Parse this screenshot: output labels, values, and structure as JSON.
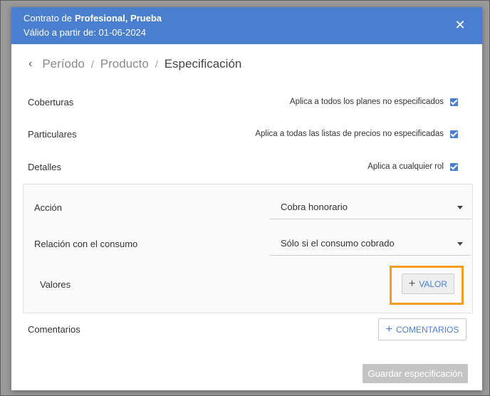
{
  "header": {
    "contract_prefix": "Contrato de",
    "contract_name": "Profesional, Prueba",
    "valid_from": "Válido a partir de: 01-06-2024",
    "close_icon": "close-icon"
  },
  "breadcrumb": {
    "back_icon": "chevron-left-icon",
    "items": [
      "Período",
      "Producto",
      "Especificación"
    ],
    "separator": "/"
  },
  "rows": [
    {
      "label": "Coberturas",
      "option": "Aplica a todos los planes no especificados",
      "checked": true
    },
    {
      "label": "Particulares",
      "option": "Aplica a todas las listas de precios no especificadas",
      "checked": true
    },
    {
      "label": "Detalles",
      "option": "Aplica a cualquier rol",
      "checked": true
    }
  ],
  "panel": {
    "accion_label": "Acción",
    "accion_value": "Cobra honorario",
    "relacion_label": "Relación con el consumo",
    "relacion_value": "Sólo si el consumo cobrado",
    "valores_label": "Valores",
    "valor_button": "VALOR"
  },
  "comentarios": {
    "label": "Comentarios",
    "button": "COMENTARIOS"
  },
  "save_button": "Guardar especificación",
  "colors": {
    "header_bg": "#4a7fcf",
    "accent": "#4a7fcf",
    "highlight": "#f29b1c",
    "disabled": "#c4c4c4"
  }
}
